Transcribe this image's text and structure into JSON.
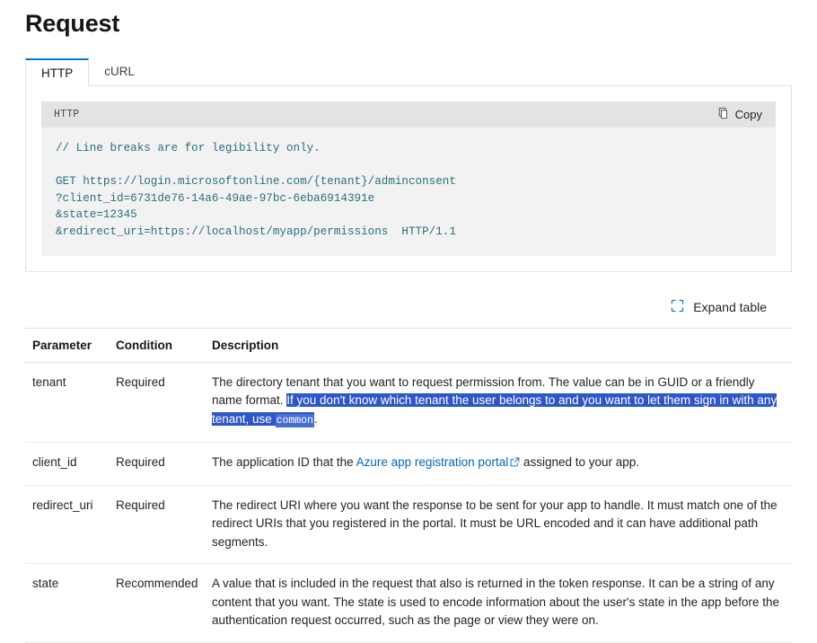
{
  "page": {
    "title": "Request"
  },
  "tabs": [
    {
      "label": "HTTP",
      "active": true
    },
    {
      "label": "cURL",
      "active": false
    }
  ],
  "code_block": {
    "language_label": "HTTP",
    "copy_label": "Copy",
    "copy_icon": "copy-icon",
    "comment_line": "// Line breaks are for legibility only.",
    "lines": [
      "GET https://login.microsoftonline.com/{tenant}/adminconsent",
      "?client_id=6731de76-14a6-49ae-97bc-6eba6914391e",
      "&state=12345",
      "&redirect_uri=https://localhost/myapp/permissions  HTTP/1.1"
    ],
    "full_text": "GET https://login.microsoftonline.com/{tenant}/adminconsent\n?client_id=6731de76-14a6-49ae-97bc-6eba6914391e\n&state=12345\n&redirect_uri=https://localhost/myapp/permissions  HTTP/1.1"
  },
  "expand_table": {
    "label": "Expand table",
    "icon": "expand-icon"
  },
  "table": {
    "headers": {
      "parameter": "Parameter",
      "condition": "Condition",
      "description": "Description"
    },
    "rows": [
      {
        "parameter": "tenant",
        "condition": "Required",
        "description_plain": "The directory tenant that you want to request permission from. The value can be in GUID or a friendly name format. If you don't know which tenant the user belongs to and you want to let them sign in with any tenant, use common.",
        "desc_pre": "The directory tenant that you want to request permission from. The value can be in GUID or a friendly name format. ",
        "desc_selected_a": "If you don't know which tenant the user belongs to and you want to let them sign in with any tenant, use ",
        "desc_selected_code": "common",
        "desc_post": "."
      },
      {
        "parameter": "client_id",
        "condition": "Required",
        "description_plain": "The application ID that the Azure app registration portal assigned to your app.",
        "desc_pre": "The application ID that the ",
        "link_text": "Azure app registration portal",
        "desc_post": " assigned to your app."
      },
      {
        "parameter": "redirect_uri",
        "condition": "Required",
        "description_plain": "The redirect URI where you want the response to be sent for your app to handle. It must match one of the redirect URIs that you registered in the portal. It must be URL encoded and it can have additional path segments."
      },
      {
        "parameter": "state",
        "condition": "Recommended",
        "description_plain": "A value that is included in the request that also is returned in the token response. It can be a string of any content that you want. The state is used to encode information about the user's state in the app before the authentication request occurred, such as the page or view they were on."
      }
    ]
  },
  "colors": {
    "accent_blue": "#0078d4",
    "link_blue": "#0067b8",
    "code_text": "#27707f",
    "selection_blue": "#2d56c8",
    "code_header_bg": "#e3e3e3",
    "code_body_bg": "#f2f2f2"
  }
}
